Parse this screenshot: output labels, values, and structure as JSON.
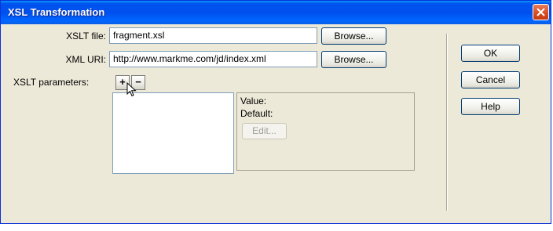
{
  "dialog": {
    "title": "XSL Transformation"
  },
  "form": {
    "xslt_file_label": "XSLT file:",
    "xslt_file_value": "fragment.xsl",
    "xml_uri_label": "XML URI:",
    "xml_uri_value": "http://www.markme.com/jd/index.xml",
    "browse_label": "Browse...",
    "params_label": "XSLT parameters:",
    "add_param_glyph": "+",
    "remove_param_glyph": "−"
  },
  "details": {
    "value_label": "Value:",
    "default_label": "Default:",
    "edit_label": "Edit..."
  },
  "actions": {
    "ok_label": "OK",
    "cancel_label": "Cancel",
    "help_label": "Help"
  },
  "colors": {
    "titlebar": "#0053ee",
    "close_button": "#d84a1f",
    "dialog_bg": "#ece9d8"
  }
}
